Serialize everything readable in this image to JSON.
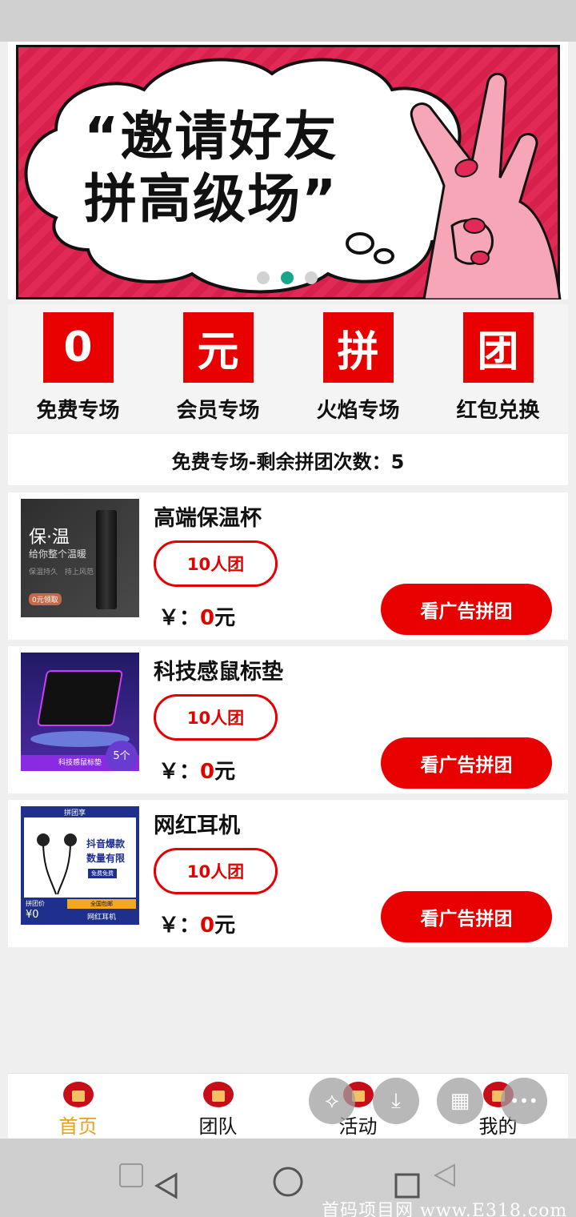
{
  "banner": {
    "line1": "“邀请好友",
    "line2": "拼高级场”",
    "dots": 3,
    "active_dot": 1
  },
  "categories": [
    {
      "icon_char": "0",
      "label": "免费专场"
    },
    {
      "icon_char": "元",
      "label": "会员专场"
    },
    {
      "icon_char": "拼",
      "label": "火焰专场"
    },
    {
      "icon_char": "团",
      "label": "红包兑换"
    }
  ],
  "remaining_text": "免费专场-剩余拼团次数：5",
  "products": [
    {
      "name": "高端保温杯",
      "group": "10人团",
      "currency": "￥：",
      "amount": "0",
      "unit": "元",
      "button": "看广告拼团",
      "thumb": {
        "title": "保·温",
        "subtitle": "给你整个温暖",
        "note1": "保温持久",
        "note2": "持上风范",
        "badge": "0元领取"
      }
    },
    {
      "name": "科技感鼠标垫",
      "group": "10人团",
      "currency": "￥：",
      "amount": "0",
      "unit": "元",
      "button": "看广告拼团",
      "thumb": {
        "caption": "科技感鼠标垫",
        "count": "5个"
      }
    },
    {
      "name": "网红耳机",
      "group": "10人团",
      "currency": "￥：",
      "amount": "0",
      "unit": "元",
      "button": "看广告拼团",
      "thumb": {
        "top": "拼团享",
        "promo1": "抖音爆款",
        "promo2": "数量有限",
        "tag": "免费免费",
        "price_label": "拼团价",
        "price": "¥0",
        "free_ship": "全国包邮",
        "caption": "网红耳机"
      }
    }
  ],
  "tabs": [
    {
      "label": "首页",
      "active": true
    },
    {
      "label": "团队",
      "active": false
    },
    {
      "label": "活动",
      "active": false
    },
    {
      "label": "我的",
      "active": false
    }
  ],
  "floating": {
    "share": "⟡",
    "download": "⤓",
    "grid": "▦",
    "more": "•••"
  },
  "watermark": "首码项目网 www.E318.com",
  "colors": {
    "accent": "#e80000",
    "active_tab": "#e8a020",
    "banner": "#e22a56"
  }
}
